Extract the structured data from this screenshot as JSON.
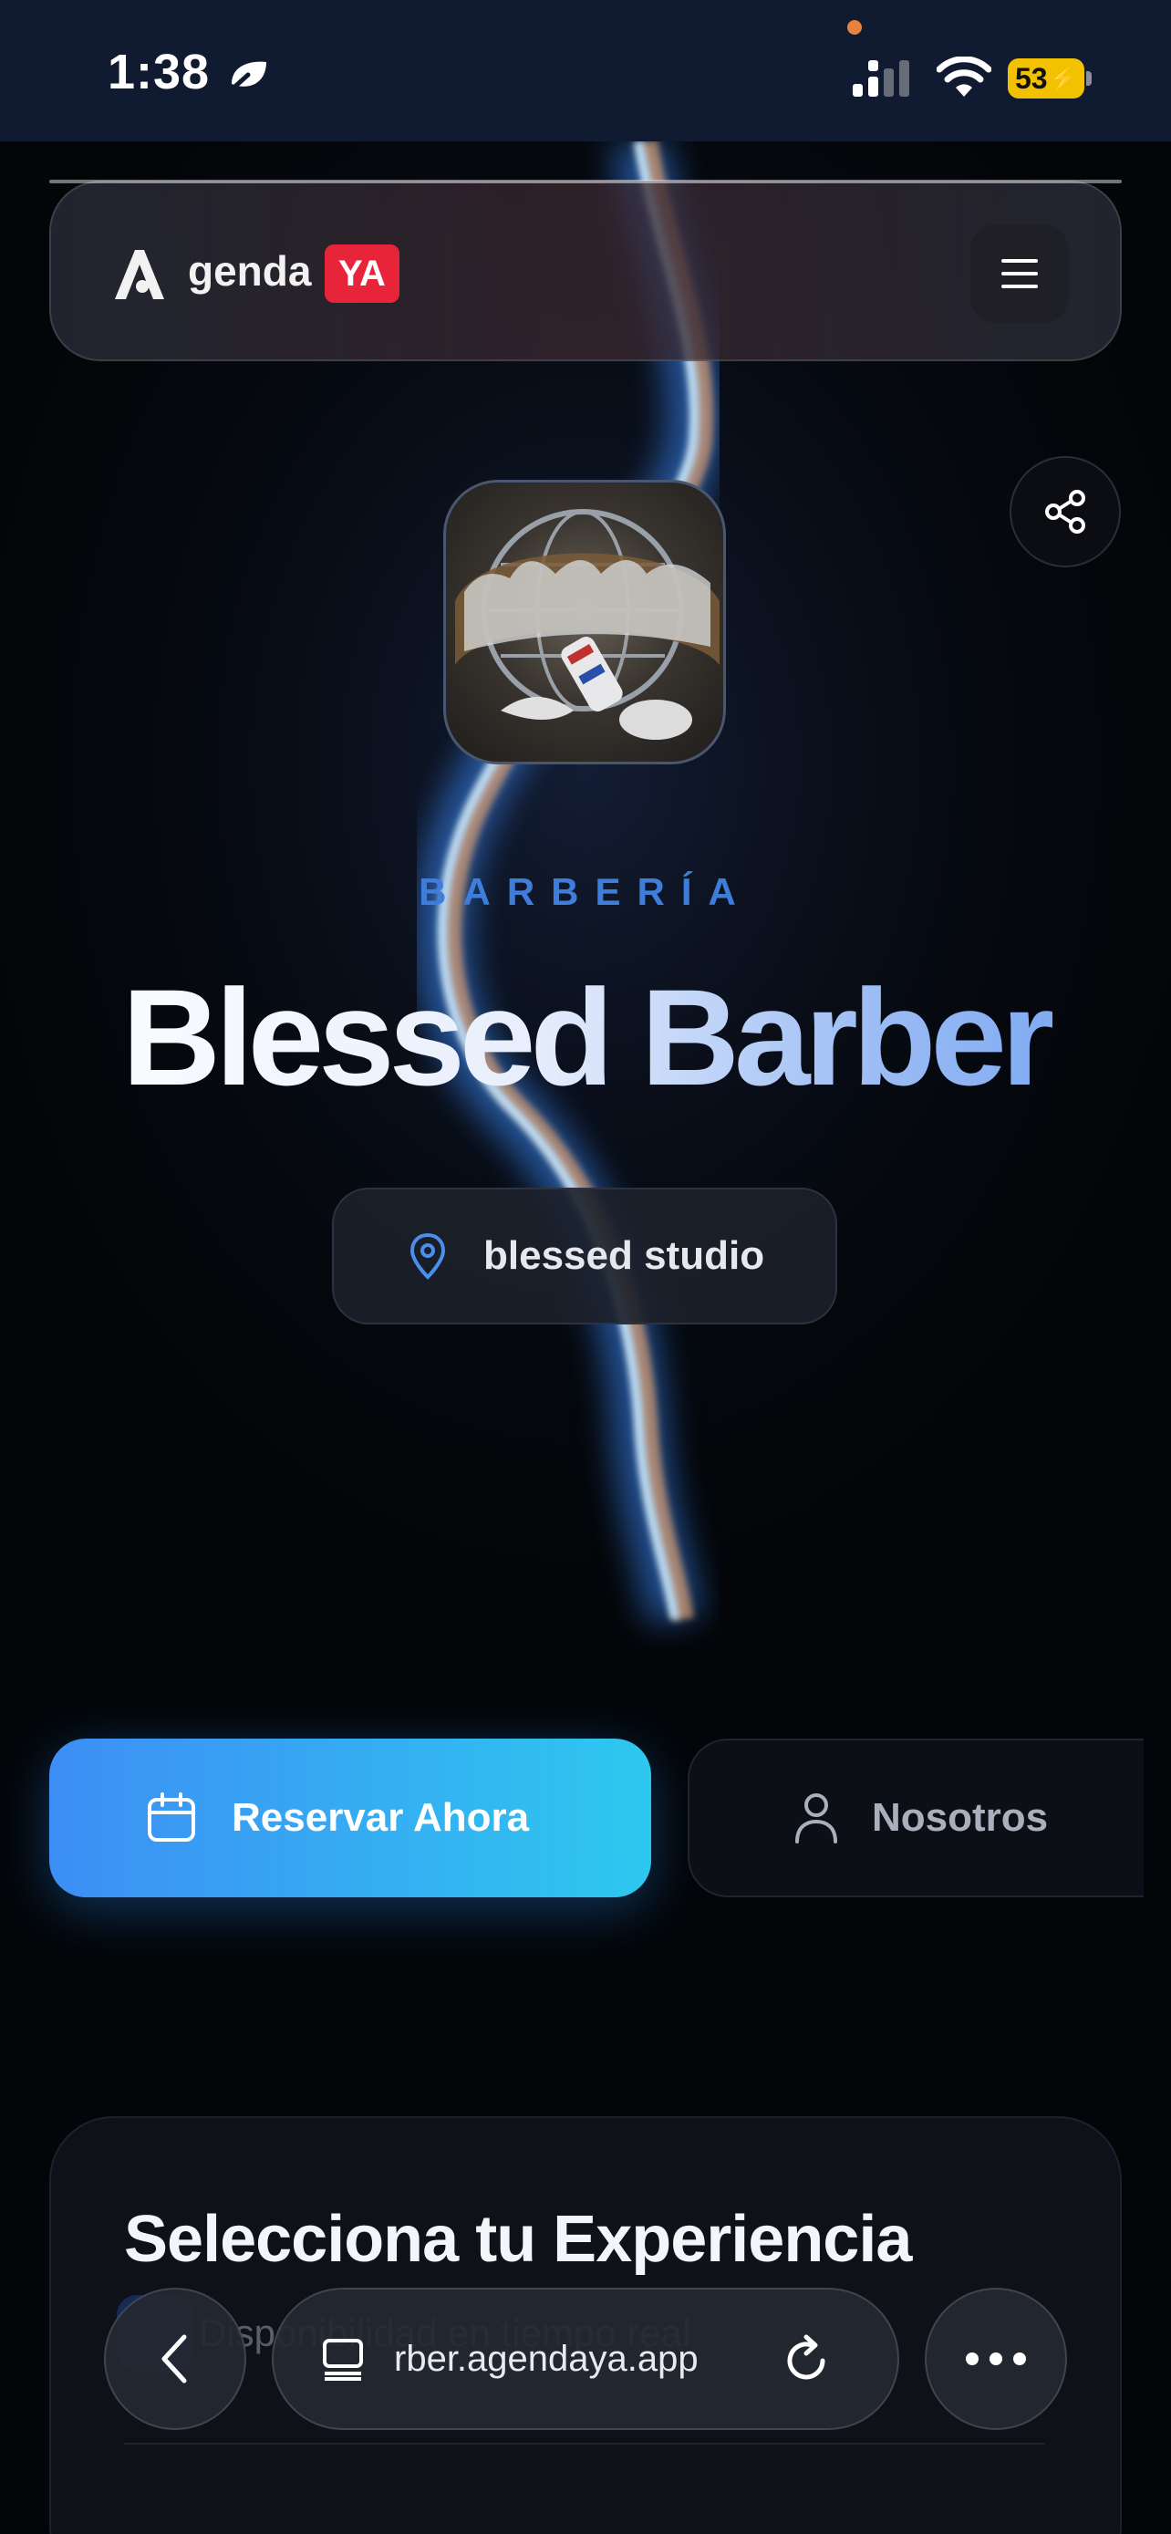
{
  "status_bar": {
    "time": "1:38",
    "battery": "53"
  },
  "header": {
    "logo_text": "genda",
    "logo_badge": "YA"
  },
  "profile": {
    "category": "BARBERÍA",
    "name": "Blessed Barber",
    "location": "blessed studio"
  },
  "actions": {
    "reserve_label": "Reservar Ahora",
    "about_label": "Nosotros"
  },
  "experience": {
    "title": "Selecciona tu Experiencia",
    "subtitle": "Disponibilidad en tiempo real"
  },
  "browser": {
    "url": "rber.agendaya.app"
  },
  "colors": {
    "accent": "#3d8ef5",
    "accent_end": "#2ec8ef",
    "badge": "#e8243a",
    "category": "#3f7ddb"
  },
  "icons": [
    "leaf-icon",
    "signal-icon",
    "wifi-icon",
    "battery-icon",
    "logo-a-icon",
    "menu-icon",
    "share-icon",
    "location-pin-icon",
    "calendar-icon",
    "user-icon",
    "back-arrow-icon",
    "tabs-icon",
    "reload-icon",
    "more-icon"
  ]
}
